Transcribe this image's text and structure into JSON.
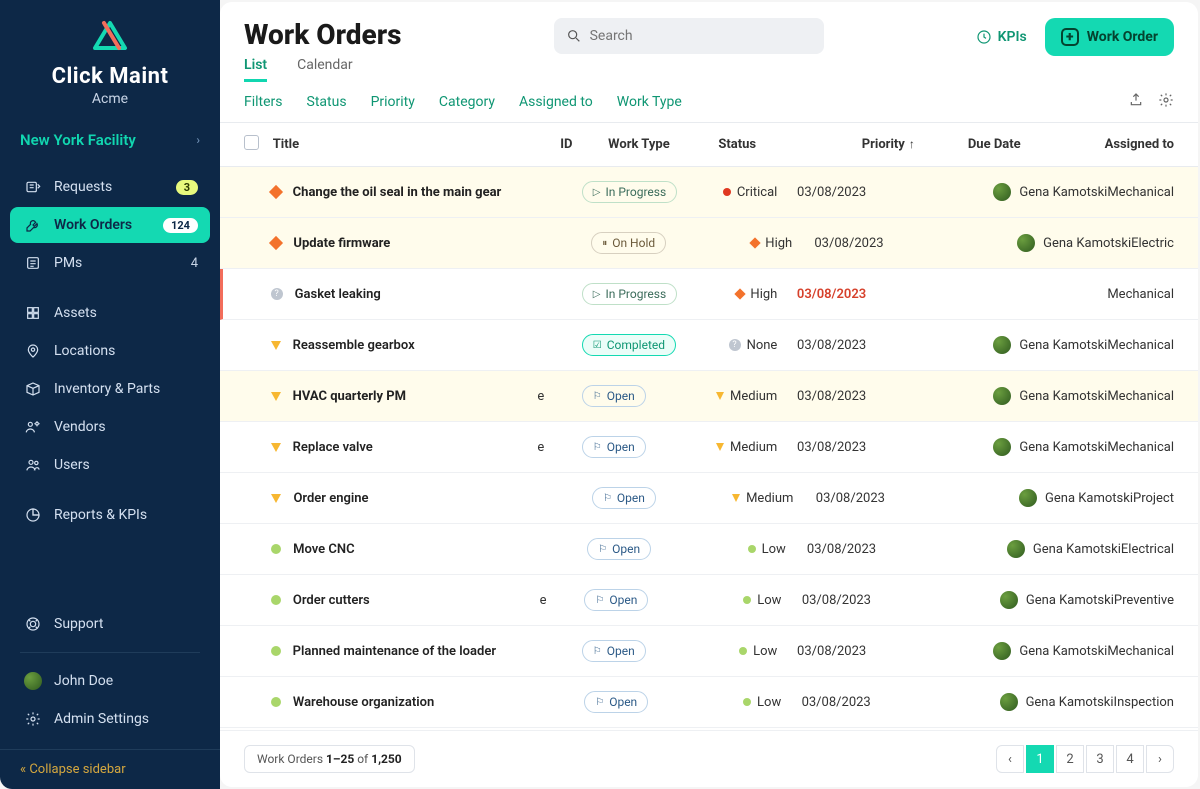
{
  "brand": {
    "name": "Click Maint",
    "org": "Acme"
  },
  "facility": "New York Facility",
  "sidebar": [
    {
      "label": "Requests",
      "badge": "3",
      "icon": "requests"
    },
    {
      "label": "Work Orders",
      "badge": "124",
      "icon": "wrench",
      "active": true
    },
    {
      "label": "PMs",
      "count": "4",
      "icon": "pm"
    },
    {
      "label": "Assets",
      "icon": "assets",
      "gap": true
    },
    {
      "label": "Locations",
      "icon": "pin"
    },
    {
      "label": "Inventory & Parts",
      "icon": "box"
    },
    {
      "label": "Vendors",
      "icon": "gear-people"
    },
    {
      "label": "Users",
      "icon": "users"
    },
    {
      "label": "Reports & KPIs",
      "icon": "pie",
      "gap": true
    }
  ],
  "sidebar_bottom": [
    {
      "label": "Support",
      "icon": "lifebuoy"
    },
    {
      "label": "John Doe",
      "icon": "avatar",
      "sep": true
    },
    {
      "label": "Admin Settings",
      "icon": "gear"
    }
  ],
  "collapse_label": "Collapse sidebar",
  "page_title": "Work Orders",
  "tabs": [
    {
      "label": "List",
      "active": true
    },
    {
      "label": "Calendar"
    }
  ],
  "search_placeholder": "Search",
  "kpis_label": "KPIs",
  "new_button_label": "Work Order",
  "filters": [
    "Filters",
    "Status",
    "Priority",
    "Category",
    "Assigned to",
    "Work Type"
  ],
  "columns": {
    "title": "Title",
    "id": "ID",
    "type": "Work Type",
    "status": "Status",
    "priority": "Priority",
    "date": "Due Date",
    "assigned": "Assigned to"
  },
  "rows": [
    {
      "title": "Change the oil seal in the main gear",
      "status": "In Progress",
      "status_kind": "progress",
      "priority": "Critical",
      "prio_icon": "critical",
      "date": "03/08/2023",
      "assignee": "Gena Kamotski",
      "category": "Mechanical",
      "hl": true,
      "dot": "critical"
    },
    {
      "title": "Update firmware",
      "status": "On Hold",
      "status_kind": "hold",
      "priority": "High",
      "prio_icon": "high",
      "date": "03/08/2023",
      "assignee": "Gena Kamotski",
      "category": "Electric",
      "hl": true,
      "dot": "high"
    },
    {
      "title": "Gasket leaking",
      "status": "In Progress",
      "status_kind": "progress",
      "priority": "High",
      "prio_icon": "high",
      "date": "03/08/2023",
      "date_red": true,
      "assignee": "",
      "category": "Mechanical",
      "urgent": true,
      "dot": "none"
    },
    {
      "title": "Reassemble gearbox",
      "status": "Completed",
      "status_kind": "completed",
      "priority": "None",
      "prio_icon": "none",
      "date": "03/08/2023",
      "assignee": "Gena Kamotski",
      "category": "Mechanical",
      "dot": "medium"
    },
    {
      "title": "HVAC quarterly PM",
      "type_suffix": "e",
      "status": "Open",
      "status_kind": "open",
      "priority": "Medium",
      "prio_icon": "medium",
      "date": "03/08/2023",
      "assignee": "Gena Kamotski",
      "category": "Mechanical",
      "hl": true,
      "dot": "medium"
    },
    {
      "title": "Replace valve",
      "type_suffix": "e",
      "status": "Open",
      "status_kind": "open",
      "priority": "Medium",
      "prio_icon": "medium",
      "date": "03/08/2023",
      "assignee": "Gena Kamotski",
      "category": "Mechanical",
      "dot": "medium"
    },
    {
      "title": "Order engine",
      "status": "Open",
      "status_kind": "open",
      "priority": "Medium",
      "prio_icon": "medium",
      "date": "03/08/2023",
      "assignee": "Gena Kamotski",
      "category": "Project",
      "dot": "medium"
    },
    {
      "title": "Move CNC",
      "status": "Open",
      "status_kind": "open",
      "priority": "Low",
      "prio_icon": "low",
      "date": "03/08/2023",
      "assignee": "Gena Kamotski",
      "category": "Electrical",
      "dot": "low"
    },
    {
      "title": "Order cutters",
      "type_suffix": "e",
      "status": "Open",
      "status_kind": "open",
      "priority": "Low",
      "prio_icon": "low",
      "date": "03/08/2023",
      "assignee": "Gena Kamotski",
      "category": "Preventive",
      "dot": "low"
    },
    {
      "title": "Planned maintenance of the loader",
      "status": "Open",
      "status_kind": "open",
      "priority": "Low",
      "prio_icon": "low",
      "date": "03/08/2023",
      "assignee": "Gena Kamotski",
      "category": "Mechanical",
      "dot": "low"
    },
    {
      "title": "Warehouse organization",
      "status": "Open",
      "status_kind": "open",
      "priority": "Low",
      "prio_icon": "low",
      "date": "03/08/2023",
      "assignee": "Gena Kamotski",
      "category": "Inspection",
      "dot": "low"
    }
  ],
  "footer": {
    "label_prefix": "Work Orders ",
    "range": "1–25",
    "of": " of ",
    "total": "1,250"
  },
  "pages": [
    "1",
    "2",
    "3",
    "4"
  ],
  "current_page": "1"
}
